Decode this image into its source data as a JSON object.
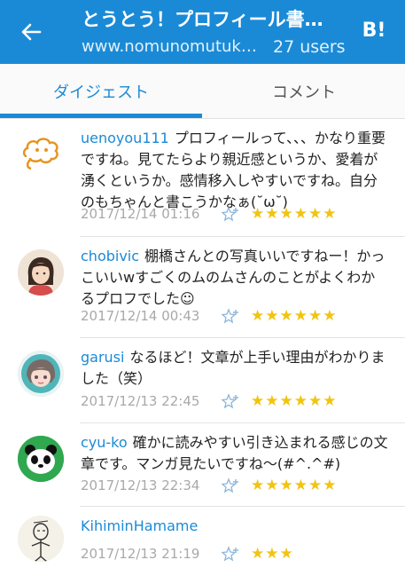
{
  "header": {
    "title": "とうとう！プロフィール書…",
    "url": "www.nomunomutuk…",
    "users": "27 users",
    "hatena_badge": "B!"
  },
  "tabs": [
    {
      "label": "ダイジェスト",
      "active": true
    },
    {
      "label": "コメント",
      "active": false
    }
  ],
  "comments": [
    {
      "user": "uenoyou111",
      "text": "プロフィールって、、、かなり重要ですね。見てたらより親近感というか、愛着が湧くというか。感情移入しやすいですね。自分のもちゃんと書こうかなぁ(˘ω˘)",
      "date": "2017/12/14 01:16",
      "stars": "★★★★★★",
      "avatar_icon": "cloud-face-icon"
    },
    {
      "user": "chobivic",
      "text": "棚橋さんとの写真いいですねー！かっこいいwすごくのムのムさんのことがよくわかるプロフでした☺",
      "date": "2017/12/14 00:43",
      "stars": "★★★★★★",
      "avatar_icon": "girl-portrait-icon"
    },
    {
      "user": "garusi",
      "text": "なるほど！文章が上手い理由がわかりました（笑）",
      "date": "2017/12/13 22:45",
      "stars": "★★★★★★",
      "avatar_icon": "girl-cyan-icon"
    },
    {
      "user": "cyu-ko",
      "text": "確かに読みやすい引き込まれる感じの文章です。マンガ見たいですね〜(#^.^#)",
      "date": "2017/12/13 22:34",
      "stars": "★★★★★★",
      "avatar_icon": "panda-icon"
    },
    {
      "user": "KihiminHamame",
      "text": "",
      "date": "2017/12/13 21:19",
      "stars": "★★★",
      "avatar_icon": "sketch-figure-icon"
    }
  ],
  "colors": {
    "primary": "#1b8ad6",
    "star": "#f1c40f",
    "date": "#a9a9a9"
  }
}
